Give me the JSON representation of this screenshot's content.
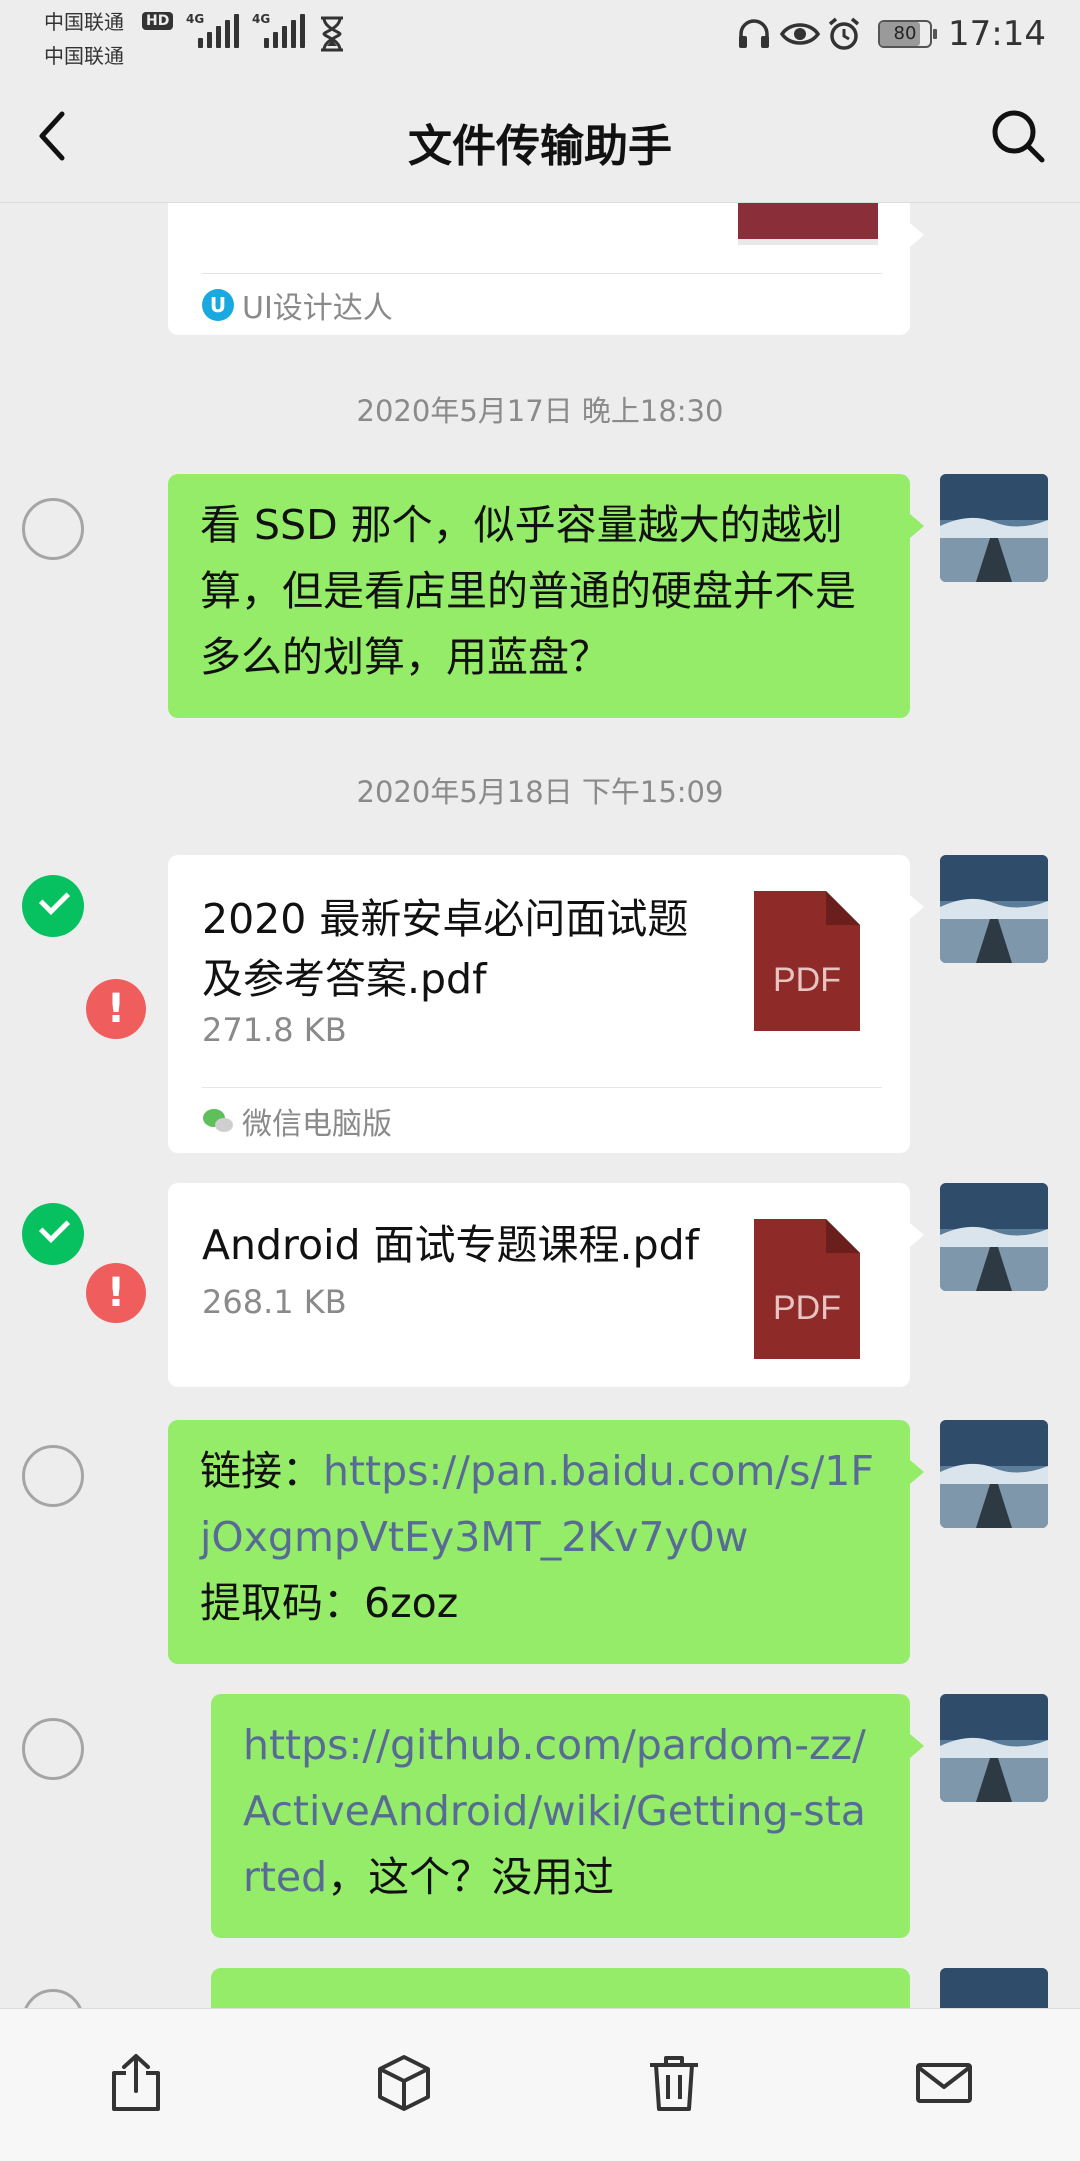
{
  "status_bar": {
    "carrier1": "中国联通",
    "carrier2": "中国联通",
    "hd": "HD",
    "net1": "4G",
    "net2": "4G",
    "battery": "80",
    "time": "17:14"
  },
  "nav": {
    "title": "文件传输助手"
  },
  "chat": {
    "top_card_source": "UI设计达人",
    "top_card_source_badge": "U",
    "timestamp1": "2020年5月17日 晚上18:30",
    "msg1": "看 SSD 那个，似乎容量越大的越划算，但是看店里的普通的硬盘并不是多么的划算，用蓝盘？",
    "timestamp2": "2020年5月18日 下午15:09",
    "file1": {
      "name": "2020 最新安卓必问面试题及参考答案.pdf",
      "size": "271.8 KB",
      "icon_label": "PDF",
      "source": "微信电脑版"
    },
    "file2": {
      "name": "Android 面试专题课程.pdf",
      "size": "268.1 KB",
      "icon_label": "PDF"
    },
    "msg3": {
      "prefix": "链接：",
      "link": "https://pan.baidu.com/s/1FjOxgmpVtEy3MT_2Kv7y0w",
      "code": "提取码：6zoz"
    },
    "msg4": {
      "link": "https://github.com/pardom-zz/ActiveAndroid/wiki/Getting-started",
      "suffix": "，这个？没用过"
    },
    "error_mark": "!"
  },
  "toolbar": {
    "icons": [
      "share-icon",
      "box-icon",
      "trash-icon",
      "mail-icon"
    ]
  },
  "colors": {
    "green_bubble": "#95ec69",
    "checked": "#07c160",
    "error": "#f05d5d",
    "link": "#576b95",
    "pdf": "#8e2b28"
  }
}
